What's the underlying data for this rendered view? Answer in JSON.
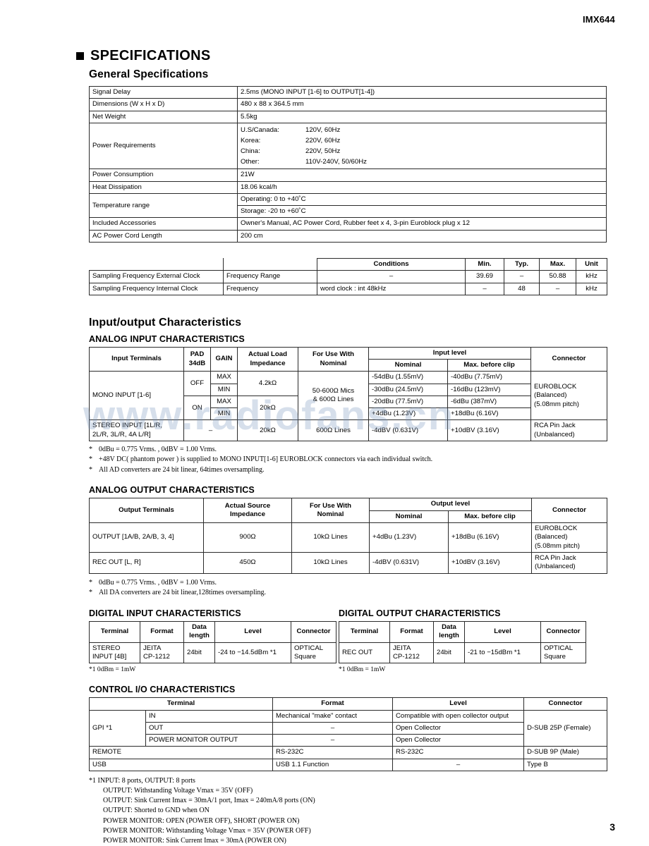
{
  "header": {
    "model": "IMX644"
  },
  "page": {
    "number": "3"
  },
  "watermark": {
    "text": "www.radiofans.cn"
  },
  "section": {
    "title": "SPECIFICATIONS",
    "general_title": "General Specifications",
    "io_title": "Input/output Characteristics"
  },
  "general": {
    "rows": [
      {
        "label": "Signal Delay",
        "value": "2.5ms (MONO INPUT [1-6] to OUTPUT[1-4])"
      },
      {
        "label": "Dimensions (W x H x D)",
        "value": "480 x 88 x 364.5 mm"
      },
      {
        "label": "Net Weight",
        "value": "5.5kg"
      },
      {
        "label": "Power Consumption",
        "value": "21W"
      },
      {
        "label": "Heat Dissipation",
        "value": "18.06 kcal/h"
      },
      {
        "label": "Included Accessories",
        "value": "Owner's Manual, AC Power Cord, Rubber feet x 4, 3-pin Euroblock plug x 12"
      },
      {
        "label": "AC Power Cord Length",
        "value": "200 cm"
      }
    ],
    "power": {
      "label": "Power Requirements",
      "items": [
        {
          "region": "U.S/Canada:",
          "spec": "120V, 60Hz"
        },
        {
          "region": "Korea:",
          "spec": "220V, 60Hz"
        },
        {
          "region": "China:",
          "spec": "220V, 50Hz"
        },
        {
          "region": "Other:",
          "spec": "110V-240V, 50/60Hz"
        }
      ]
    },
    "temperature": {
      "label": "Temperature range",
      "operating": "Operating: 0 to +40˚C",
      "storage": "Storage: -20 to +60˚C"
    }
  },
  "sampling": {
    "headers": [
      "Conditions",
      "Min.",
      "Typ.",
      "Max.",
      "Unit"
    ],
    "rows": [
      {
        "name": "Sampling Frequency External Clock",
        "param": "Frequency Range",
        "conditions": "–",
        "min": "39.69",
        "typ": "–",
        "max": "50.88",
        "unit": "kHz"
      },
      {
        "name": "Sampling Frequency Internal Clock",
        "param": "Frequency",
        "conditions": "word clock : int 48kHz",
        "min": "–",
        "typ": "48",
        "max": "–",
        "unit": "kHz"
      }
    ]
  },
  "analog_input": {
    "caption": "ANALOG INPUT CHARACTERISTICS",
    "headers": {
      "terminals": "Input Terminals",
      "pad": "PAD\n34dB",
      "pad_l1": "PAD",
      "pad_l2": "34dB",
      "gain": "GAIN",
      "load_l1": "Actual Load",
      "load_l2": "Impedance",
      "use_l1": "For Use With",
      "use_l2": "Nominal",
      "level": "Input level",
      "nominal": "Nominal",
      "maxclip": "Max. before clip",
      "connector": "Connector"
    },
    "mono": {
      "terminal": "MONO INPUT [1-6]",
      "use_with_l1": "50-600Ω Mics",
      "use_with_l2": "& 600Ω Lines",
      "rows": [
        {
          "pad": "OFF",
          "gain": "MAX",
          "load": "4.2kΩ",
          "nominal": "-54dBu (1.55mV)",
          "maxclip": "-40dBu (7.75mV)"
        },
        {
          "pad": "OFF",
          "gain": "MIN",
          "load": "4.2kΩ",
          "nominal": "-30dBu (24.5mV)",
          "maxclip": "-16dBu (123mV)"
        },
        {
          "pad": "ON",
          "gain": "MAX",
          "load": "20kΩ",
          "nominal": "-20dBu (77.5mV)",
          "maxclip": "-6dBu (387mV)"
        },
        {
          "pad": "ON",
          "gain": "MIN",
          "load": "20kΩ",
          "nominal": "+4dBu (1.23V)",
          "maxclip": "+18dBu (6.16V)"
        }
      ],
      "connector_l1": "EUROBLOCK",
      "connector_l2": "(Balanced)",
      "connector_l3": "(5.08mm pitch)"
    },
    "stereo": {
      "terminal_l1": "STEREO INPUT [1L/R,",
      "terminal_l2": "2L/R, 3L/R, 4A L/R]",
      "pad": "–",
      "load": "20kΩ",
      "use_with": "600Ω Lines",
      "nominal": "-4dBV (0.631V)",
      "maxclip": "+10dBV (3.16V)",
      "connector_l1": "RCA Pin Jack",
      "connector_l2": "(Unbalanced)"
    },
    "notes": [
      "0dBu = 0.775 Vrms. , 0dBV = 1.00 Vrms.",
      "+48V DC( phantom power ) is supplied to MONO INPUT[1-6] EUROBLOCK connectors via each individual switch.",
      "All AD converters are 24 bit linear, 64times oversampling."
    ]
  },
  "analog_output": {
    "caption": "ANALOG OUTPUT CHARACTERISTICS",
    "headers": {
      "terminals": "Output Terminals",
      "source_l1": "Actual Source",
      "source_l2": "Impedance",
      "use_l1": "For Use With",
      "use_l2": "Nominal",
      "level": "Output level",
      "nominal": "Nominal",
      "maxclip": "Max. before clip",
      "connector": "Connector"
    },
    "rows": [
      {
        "terminal": "OUTPUT [1A/B, 2A/B, 3, 4]",
        "impedance": "900Ω",
        "use_with": "10kΩ Lines",
        "nominal": "+4dBu (1.23V)",
        "maxclip": "+18dBu (6.16V)",
        "connector_l1": "EUROBLOCK",
        "connector_l2": "(Balanced)",
        "connector_l3": "(5.08mm pitch)"
      },
      {
        "terminal": "REC OUT [L, R]",
        "impedance": "450Ω",
        "use_with": "10kΩ Lines",
        "nominal": "-4dBV (0.631V)",
        "maxclip": "+10dBV (3.16V)",
        "connector_l1": "RCA Pin Jack",
        "connector_l2": "(Unbalanced)",
        "connector_l3": ""
      }
    ],
    "notes": [
      "0dBu = 0.775 Vrms. , 0dBV = 1.00 Vrms.",
      "All DA converters are 24 bit linear,128times oversampling."
    ]
  },
  "digital_input": {
    "caption": "DIGITAL INPUT CHARACTERISTICS",
    "headers": [
      "Terminal",
      "Format",
      "Data length",
      "Level",
      "Connector"
    ],
    "h_data_l1": "Data",
    "h_data_l2": "length",
    "row": {
      "terminal_l1": "STEREO",
      "terminal_l2": "INPUT [4B]",
      "format_l1": "JEITA",
      "format_l2": "CP-1212",
      "data_length": "24bit",
      "level": "-24 to −14.5dBm *1",
      "connector_l1": "OPTICAL",
      "connector_l2": "Square"
    },
    "note": "*1    0dBm = 1mW"
  },
  "digital_output": {
    "caption": "DIGITAL OUTPUT CHARACTERISTICS",
    "headers": [
      "Terminal",
      "Format",
      "Data length",
      "Level",
      "Connector"
    ],
    "h_data_l1": "Data",
    "h_data_l2": "length",
    "row": {
      "terminal": "REC OUT",
      "format_l1": "JEITA",
      "format_l2": "CP-1212",
      "data_length": "24bit",
      "level": "-21 to −15dBm *1",
      "connector_l1": "OPTICAL",
      "connector_l2": "Square"
    },
    "note": "*1    0dBm = 1mW"
  },
  "control_io": {
    "caption": "CONTROL I/O CHARACTERISTICS",
    "headers": {
      "terminal": "Terminal",
      "format": "Format",
      "level": "Level",
      "connector": "Connector"
    },
    "gpi": {
      "name": "GPI *1",
      "connector": "D-SUB 25P (Female)",
      "rows": [
        {
          "sub": "IN",
          "format": "Mechanical \"make\" contact",
          "level": "Compatible with open collector output"
        },
        {
          "sub": "OUT",
          "format": "–",
          "level": "Open Collector"
        },
        {
          "sub": "POWER MONITOR OUTPUT",
          "format": "–",
          "level": "Open Collector"
        }
      ]
    },
    "rows": [
      {
        "terminal": "REMOTE",
        "format": "RS-232C",
        "level": "RS-232C",
        "connector": "D-SUB 9P (Male)"
      },
      {
        "terminal": "USB",
        "format": "USB 1.1  Function",
        "level": "–",
        "connector": "Type B"
      }
    ],
    "notes": [
      "*1 INPUT: 8 ports, OUTPUT: 8 ports",
      "OUTPUT: Withstanding Voltage Vmax = 35V (OFF)",
      "OUTPUT: Sink Current Imax = 30mA/1 port, Imax = 240mA/8 ports (ON)",
      "OUTPUT: Shorted to GND when ON",
      "POWER MONITOR: OPEN (POWER OFF), SHORT (POWER ON)",
      "POWER MONITOR: Withstanding Voltage Vmax = 35V (POWER OFF)",
      "POWER MONITOR: Sink Current Imax = 30mA (POWER ON)"
    ]
  }
}
